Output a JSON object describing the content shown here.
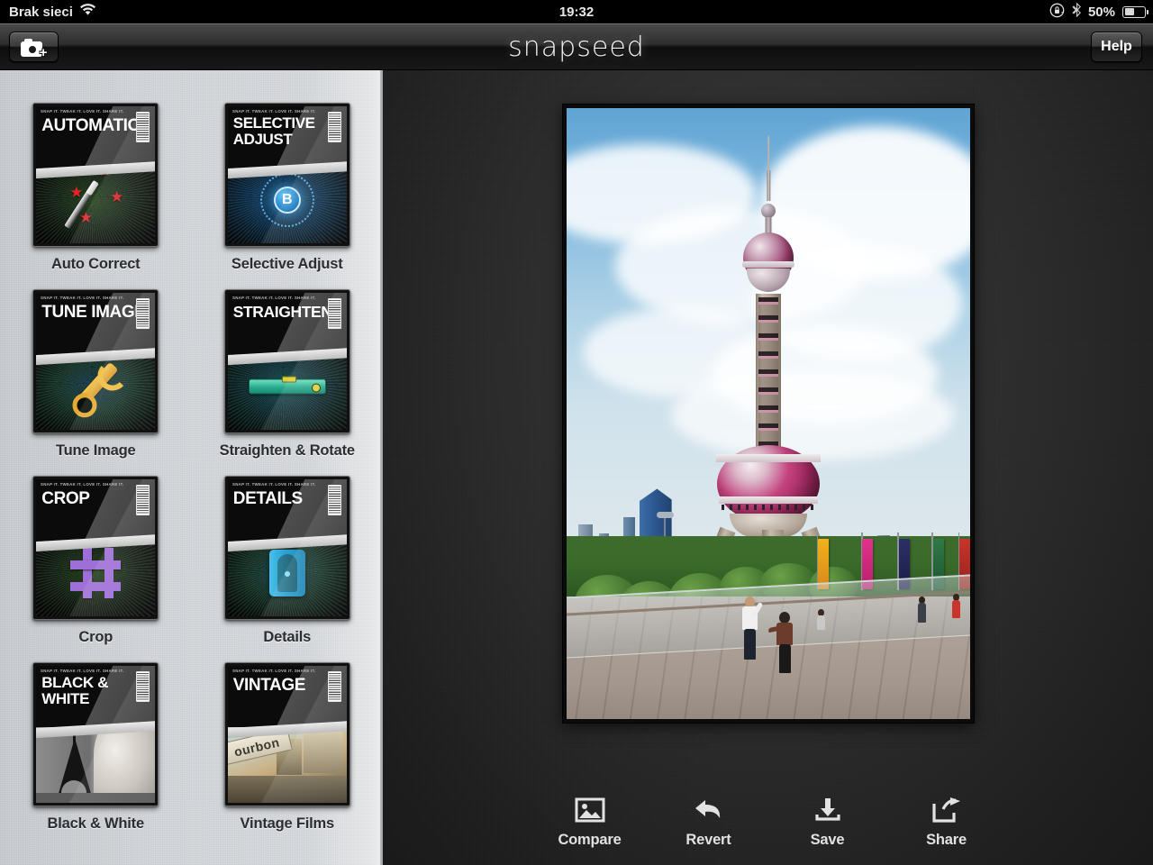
{
  "status_bar": {
    "carrier": "Brak sieci",
    "wifi_icon": "wifi-icon",
    "time": "19:32",
    "rotation_lock_icon": "rotation-lock-icon",
    "bluetooth_icon": "bluetooth-icon",
    "battery_percent": "50%",
    "battery_icon": "battery-icon"
  },
  "nav_bar": {
    "open_image_icon": "camera-plus-icon",
    "app_title": "snapseed",
    "help_label": "Help"
  },
  "sidebar": {
    "tagline": "SNAP IT. TWEAK IT. LOVE IT. SHARE IT.",
    "filters": [
      {
        "card_title": "AUTOMATIC",
        "label": "Auto Correct",
        "icon": "magic-wand-icon"
      },
      {
        "card_title": "SELECTIVE ADJUST",
        "label": "Selective Adjust",
        "icon": "selective-b-icon",
        "badge": "B"
      },
      {
        "card_title": "TUNE IMAGE",
        "label": "Tune Image",
        "icon": "wrench-icon"
      },
      {
        "card_title": "STRAIGHTEN",
        "label": "Straighten & Rotate",
        "icon": "spirit-level-icon"
      },
      {
        "card_title": "CROP",
        "label": "Crop",
        "icon": "crop-marks-icon"
      },
      {
        "card_title": "DETAILS",
        "label": "Details",
        "icon": "pencil-sharpener-icon"
      },
      {
        "card_title": "BLACK & WHITE",
        "label": "Black & White",
        "icon": "eiffel-tower-photo"
      },
      {
        "card_title": "VINTAGE",
        "label": "Vintage Films",
        "icon": "bourbon-street-photo",
        "sign_text": "ourbon"
      }
    ]
  },
  "main": {
    "photo_description": "Oriental Pearl Tower, Shanghai, viewed from plaza with flags and visitors",
    "toolbar": [
      {
        "label": "Compare",
        "icon": "image-icon"
      },
      {
        "label": "Revert",
        "icon": "undo-arrow-icon"
      },
      {
        "label": "Save",
        "icon": "download-icon"
      },
      {
        "label": "Share",
        "icon": "share-icon"
      }
    ]
  },
  "colors": {
    "sidebar_bg": "#d3d6da",
    "main_bg": "#2c2c2c",
    "navbar_bg": "#1a1a1a",
    "label_text": "#2b2d30",
    "toolbar_text": "#e2e2e2"
  }
}
